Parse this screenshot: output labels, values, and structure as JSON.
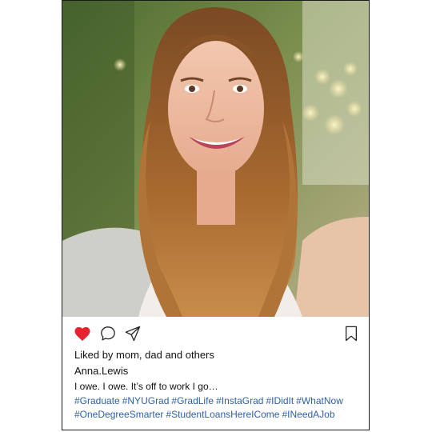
{
  "post": {
    "photo_alt": "photo",
    "actions": {
      "like_icon": "heart-icon",
      "comment_icon": "comment-icon",
      "share_icon": "paper-plane-icon",
      "save_icon": "bookmark-icon",
      "liked_color": "#e8222e"
    },
    "likes_text": "Liked by mom, dad and others",
    "username": "Anna.Lewis",
    "caption": "I owe. I owe. It’s off to work I go…",
    "hashtags": [
      "#Graduate",
      "#NYUGrad",
      "#GradLife",
      "#InstaGrad",
      "#IDidIt",
      "#WhatNow",
      "#OneDegreeSmarter",
      "#StudentLoansHereICome",
      "#INeedAJob"
    ],
    "hashtag_color": "#2f5fa8"
  }
}
